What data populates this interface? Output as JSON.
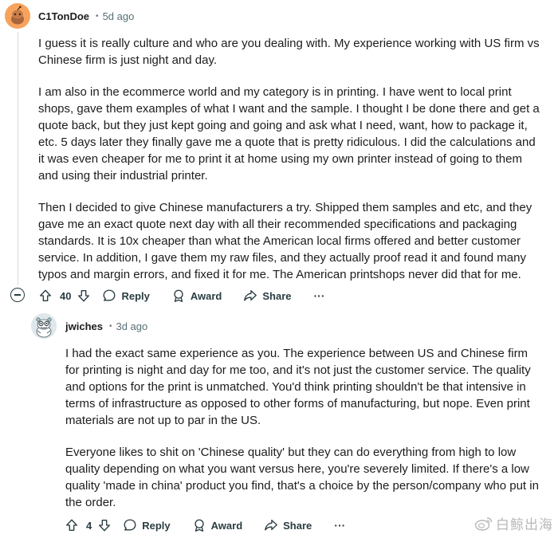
{
  "comment1": {
    "username": "C1TonDoe",
    "time": "5d ago",
    "paragraphs": [
      "I guess it is really culture and who are you dealing with. My experience working with US firm vs Chinese firm is just night and day.",
      "I am also in the ecommerce world and my category is in printing. I have went to local print shops, gave them examples of what I want and the sample. I thought I be done there and get a quote back, but they just kept going and going and ask what I need, want, how to package it, etc. 5 days later they finally gave me a quote that is pretty ridiculous. I did the calculations and it was even cheaper for me to print it at home using my own printer instead of going to them and using their industrial printer.",
      "Then I decided to give Chinese manufacturers a try. Shipped them samples and etc, and they gave me an exact quote next day with all their recommended specifications and packaging standards. It is 10x cheaper than what the American local firms offered and better customer service. In addition, I gave them my raw files, and they actually proof read it and found many typos and margin errors, and fixed it for me. The American printshops never did that for me."
    ],
    "votes": "40",
    "reply_label": "Reply",
    "award_label": "Award",
    "share_label": "Share",
    "more_label": "···"
  },
  "comment2": {
    "username": "jwiches",
    "time": "3d ago",
    "paragraphs": [
      "I had the exact same experience as you. The experience between US and Chinese firm for printing is night and day for me too, and it's not just the customer service. The quality and options for the print is unmatched. You'd think printing shouldn't be that intensive in terms of infrastructure as opposed to other forms of manufacturing, but nope. Even print materials are not up to par in the US.",
      "Everyone likes to shit on 'Chinese quality' but they can do everything from high to low quality depending on what you want versus here, you're severely limited. If there's a low quality 'made in china' product you find, that's a choice by the person/company who put in the order."
    ],
    "votes": "4",
    "reply_label": "Reply",
    "award_label": "Award",
    "share_label": "Share",
    "more_label": "···"
  },
  "watermark": {
    "text": "白鲸出海"
  },
  "colors": {
    "avatar1_bg": "#f7a35c",
    "avatar2_bg": "#dfe7ea",
    "text": "#1c1c1c",
    "meta": "#576f76",
    "action": "#2a3c42"
  }
}
